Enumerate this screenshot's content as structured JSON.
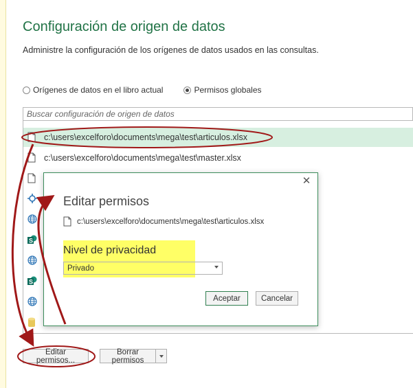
{
  "dialog": {
    "title": "Configuración de origen de datos",
    "description": "Administre la configuración de los orígenes de datos usados en las consultas."
  },
  "scope": {
    "options": [
      {
        "label": "Orígenes de datos en el libro actual",
        "checked": false
      },
      {
        "label": "Permisos globales",
        "checked": true
      }
    ]
  },
  "search": {
    "placeholder": "Buscar configuración de origen de datos"
  },
  "sources": [
    {
      "icon": "file-icon",
      "label": "c:\\users\\excelforo\\documents\\mega\\test\\articulos.xlsx",
      "selected": true
    },
    {
      "icon": "file-icon",
      "label": "c:\\users\\excelforo\\documents\\mega\\test\\master.xlsx",
      "selected": false
    },
    {
      "icon": "file-icon",
      "label": "",
      "selected": false
    },
    {
      "icon": "odata-feed-icon",
      "label": "",
      "selected": false
    },
    {
      "icon": "globe-icon",
      "label": "",
      "selected": false
    },
    {
      "icon": "sharepoint-icon",
      "label": "",
      "selected": false
    },
    {
      "icon": "globe-icon",
      "label": "",
      "selected": false
    },
    {
      "icon": "sharepoint-icon",
      "label": "",
      "selected": false
    },
    {
      "icon": "globe-icon",
      "label": "",
      "selected": false
    },
    {
      "icon": "database-icon",
      "label": "",
      "selected": false
    }
  ],
  "buttons": {
    "edit_permissions": "Editar permisos...",
    "clear_permissions": "Borrar permisos"
  },
  "edit_dialog": {
    "title": "Editar permisos",
    "path": "c:\\users\\excelforo\\documents\\mega\\test\\articulos.xlsx",
    "privacy_label": "Nivel de privacidad",
    "privacy_value": "Privado",
    "accept": "Aceptar",
    "cancel": "Cancelar",
    "close_glyph": "✕"
  },
  "colors": {
    "title_green": "#217346",
    "selected_row": "#d7efe0",
    "highlight_yellow": "#ffff66",
    "annotation_red": "#a01818"
  }
}
